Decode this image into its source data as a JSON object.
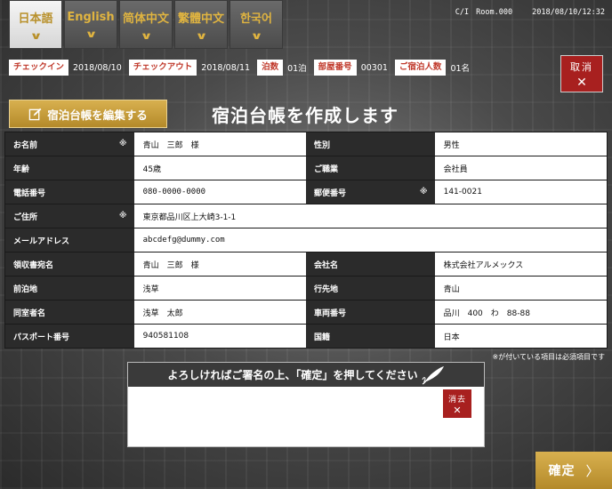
{
  "languages": [
    {
      "label": "日本語",
      "active": true
    },
    {
      "label": "English",
      "active": false
    },
    {
      "label": "简体中文",
      "active": false
    },
    {
      "label": "繁體中文",
      "active": false
    },
    {
      "label": "한국어",
      "active": false
    }
  ],
  "header": {
    "terminal": "C/I",
    "room": "Room.000",
    "datetime": "2018/08/10/12:32"
  },
  "info_bar": [
    {
      "label": "チェックイン",
      "value": "2018/08/10"
    },
    {
      "label": "チェックアウト",
      "value": "2018/08/11"
    },
    {
      "label": "泊数",
      "value": "01泊"
    },
    {
      "label": "部屋番号",
      "value": "00301"
    },
    {
      "label": "ご宿泊人数",
      "value": "01名"
    }
  ],
  "cancel": {
    "label": "取消",
    "icon": "close-icon"
  },
  "edit_button": {
    "label": "宿泊台帳を編集する",
    "icon": "edit-icon"
  },
  "title": "宿泊台帳を作成します",
  "required_mark": "※",
  "form": {
    "name_label": "お名前",
    "name_value": "青山　三郎　様",
    "gender_label": "性別",
    "gender_value": "男性",
    "age_label": "年齢",
    "age_value": "45歳",
    "occupation_label": "ご職業",
    "occupation_value": "会社員",
    "phone_label": "電話番号",
    "phone_value": "080-0000-0000",
    "postal_label": "郵便番号",
    "postal_value": "141-0021",
    "address_label": "ご住所",
    "address_value": "東京都品川区上大崎3-1-1",
    "email_label": "メールアドレス",
    "email_value": "abcdefg@dummy.com",
    "receipt_label": "領収書宛名",
    "receipt_value": "青山　三郎　様",
    "company_label": "会社名",
    "company_value": "株式会社アルメックス",
    "prev_label": "前泊地",
    "prev_value": "浅草",
    "next_label": "行先地",
    "next_value": "青山",
    "companion_label": "同室者名",
    "companion_value": "浅草　太郎",
    "vehicle_label": "車両番号",
    "vehicle_value": "品川　400　わ　88-88",
    "passport_label": "パスポート番号",
    "passport_value": "940581108",
    "nationality_label": "国籍",
    "nationality_value": "日本"
  },
  "required_note": "※が付いている項目は必須項目です",
  "signature": {
    "prompt": "よろしければご署名の上、「確定」を押してください",
    "erase_label": "消去"
  },
  "confirm": {
    "label": "確定"
  },
  "colors": {
    "accent": "#c9a13d",
    "cancel": "#a8201f",
    "label_bg": "#2b2b2b"
  }
}
